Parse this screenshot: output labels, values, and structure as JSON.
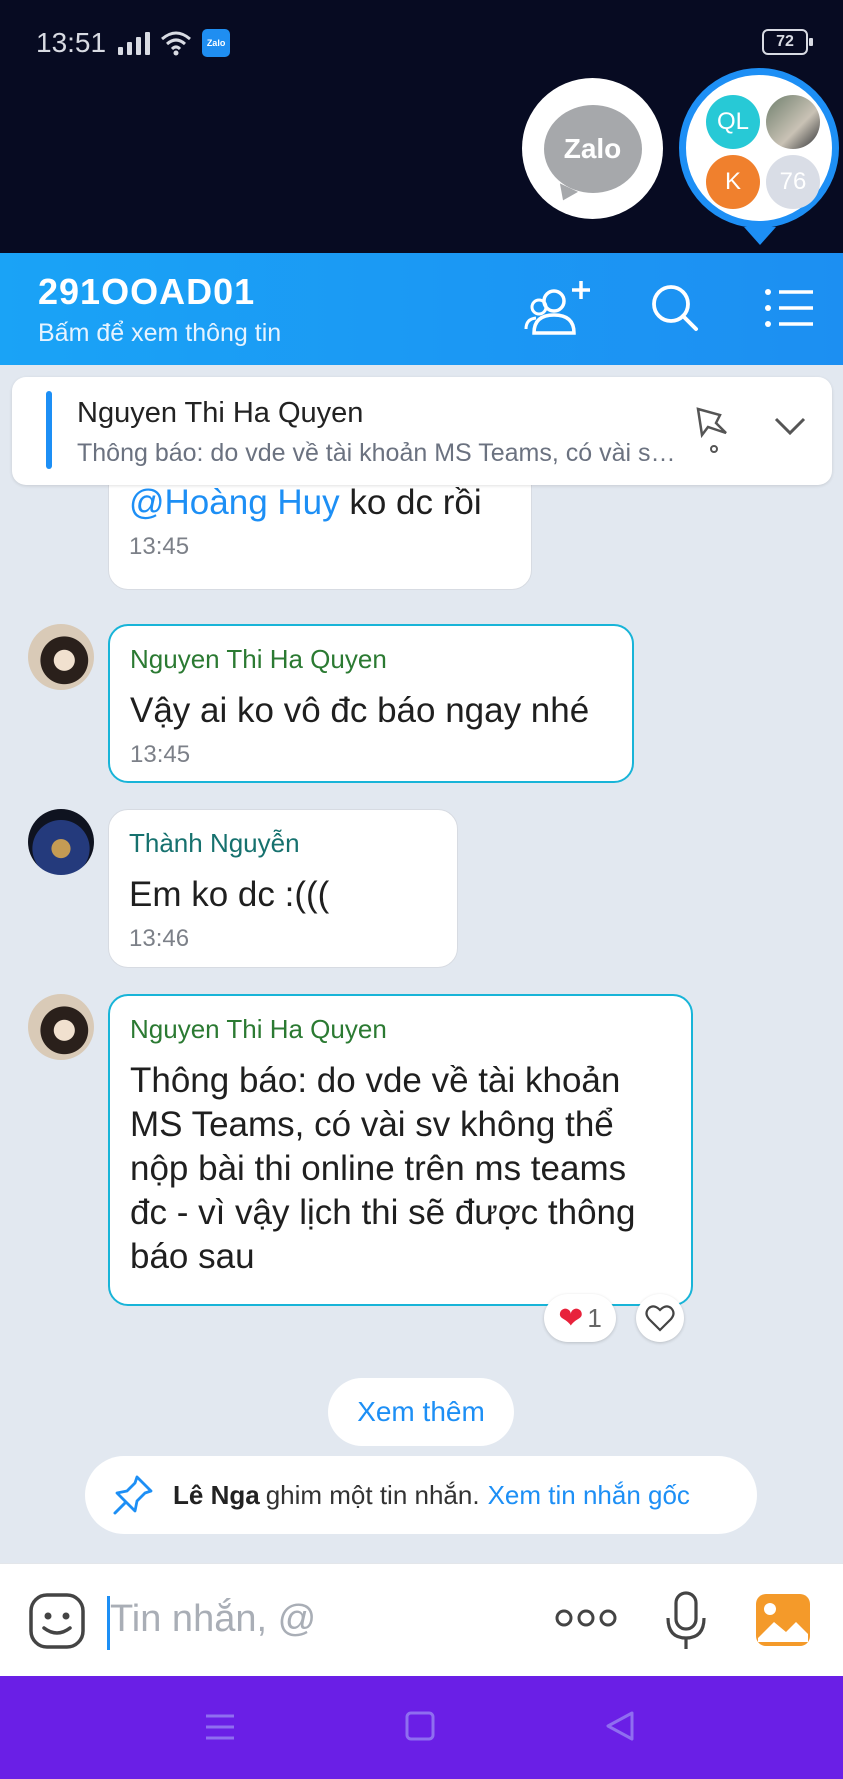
{
  "status_bar": {
    "time": "13:51",
    "battery": "72",
    "zalo_badge": "Zalo"
  },
  "floating": {
    "zalo_label": "Zalo",
    "group_avatars": [
      "QL",
      "K",
      "76"
    ]
  },
  "header": {
    "title": "291OOAD01",
    "subtitle": "Bấm để xem thông tin"
  },
  "pinned": {
    "sender": "Nguyen Thi Ha Quyen",
    "preview": "Thông báo: do vde về tài khoản MS Teams, có vài sv không thể nộp bài thi online trên ms teams đc"
  },
  "messages": [
    {
      "mention": "@Hoàng Huy",
      "text": " ko dc rồi",
      "time": "13:45"
    },
    {
      "sender": "Nguyen Thi Ha Quyen",
      "text": "Vậy ai ko vô đc báo ngay nhé",
      "time": "13:45"
    },
    {
      "sender": "Thành Nguyễn",
      "text": "Em ko dc :(((",
      "time": "13:46"
    },
    {
      "sender": "Nguyen Thi Ha Quyen",
      "text": "Thông báo: do vde về tài khoản MS Teams, có vài sv không thể nộp bài thi online trên ms teams đc - vì vậy lịch thi sẽ được thông báo sau",
      "reaction_count": "1"
    }
  ],
  "see_more": "Xem thêm",
  "pin_note": {
    "who": "Lê Nga",
    "action": "ghim một tin nhắn.",
    "link": "Xem tin nhắn gốc"
  },
  "input": {
    "placeholder": "Tin nhắn, @"
  },
  "colors": {
    "accent": "#1d8ff5",
    "header": "#1aa3f6",
    "navbar": "#6a1fe6"
  }
}
